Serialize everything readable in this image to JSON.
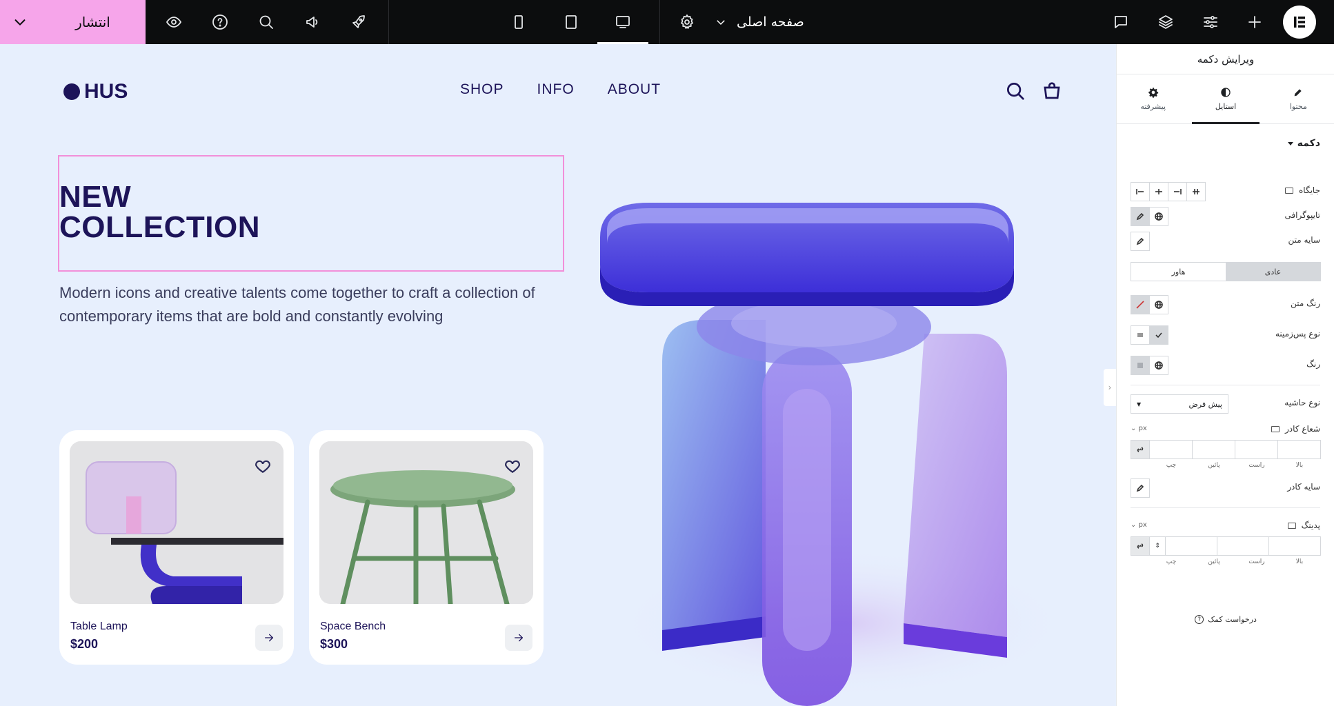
{
  "topbar": {
    "publish_label": "انتشار",
    "page_name": "صفحه اصلی",
    "icons": [
      "chevron-down-icon",
      "eye-icon",
      "help-icon",
      "search-icon",
      "megaphone-icon",
      "rocket-icon",
      "mobile-icon",
      "tablet-icon",
      "desktop-icon",
      "gear-icon",
      "chevron-down-icon",
      "comment-icon",
      "layers-icon",
      "sliders-icon",
      "plus-icon",
      "elementor-logo"
    ],
    "accent": "#f6a5ea"
  },
  "site": {
    "brand": "HUS",
    "nav": [
      "SHOP",
      "INFO",
      "ABOUT"
    ],
    "headline_line1": "NEW",
    "headline_line2": "COLLECTION",
    "lead": "Modern icons and creative talents come together to craft a collection of contemporary items that are bold and constantly evolving",
    "products": [
      {
        "name": "Table Lamp",
        "price": "$200"
      },
      {
        "name": "Space Bench",
        "price": "$300"
      }
    ],
    "brand_color": "#1d1459",
    "selection_color": "#f28fd9"
  },
  "panel": {
    "title": "ویرایش دکمه",
    "tabs": {
      "content": "محتوا",
      "style": "استایل",
      "advanced": "پیشرفته"
    },
    "section": "دکمه",
    "labels": {
      "position": "جایگاه",
      "typography": "تایپوگرافی",
      "text_shadow": "سایه متن",
      "text_color": "رنگ متن",
      "background_type": "نوع پس‌زمینه",
      "color": "رنگ",
      "border_type": "نوع حاشیه",
      "border_radius": "شعاع کادر",
      "box_shadow": "سایه کادر",
      "padding": "پدینگ"
    },
    "state_normal": "عادی",
    "state_hover": "هاور",
    "border_type_value": "پیش فرض",
    "unit": "px",
    "sides": [
      "بالا",
      "راست",
      "پائین",
      "چپ"
    ],
    "help": "درخواست کمک"
  }
}
